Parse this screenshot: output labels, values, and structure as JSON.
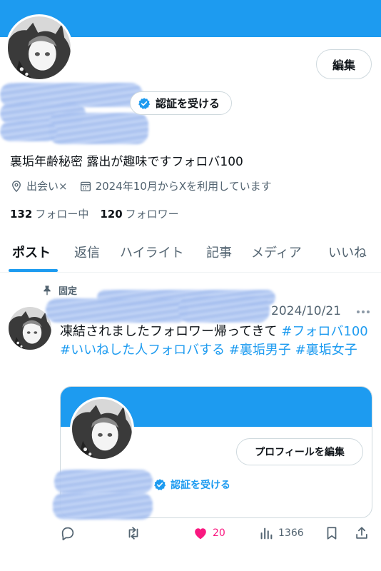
{
  "profile": {
    "edit_label": "編集",
    "verify_label": "認証を受ける",
    "bio": "裏垢年齢秘密 露出が趣味ですフォロバ100",
    "location": "出会い×",
    "joined": "2024年10月からXを利用しています",
    "following_count": "132",
    "following_label": "フォロー中",
    "followers_count": "120",
    "followers_label": "フォロワー"
  },
  "tabs": [
    {
      "label": "ポスト",
      "active": true
    },
    {
      "label": "返信"
    },
    {
      "label": "ハイライト"
    },
    {
      "label": "記事"
    },
    {
      "label": "メディア"
    },
    {
      "label": "いいね"
    }
  ],
  "post": {
    "pinned_label": "固定",
    "date": "2024/10/21",
    "text_plain": "凍結されましたフォロワー帰ってきて ",
    "tags": [
      "#フォロバ100",
      "#いいねした人フォロバする",
      "#裏垢男子",
      "#裏垢女子"
    ],
    "card": {
      "edit_profile_label": "プロフィールを編集",
      "verify_label": "認証を受ける"
    },
    "actions": {
      "reply_icon": "reply-icon",
      "repost_icon": "repost-icon",
      "like_icon": "heart-icon",
      "like_count": "20",
      "views_icon": "views-icon",
      "views_count": "1366",
      "bookmark_icon": "bookmark-icon",
      "share_icon": "share-icon"
    }
  },
  "colors": {
    "accent": "#1d9bf0",
    "text": "#0f1419",
    "muted": "#536471",
    "like": "#f91880"
  }
}
